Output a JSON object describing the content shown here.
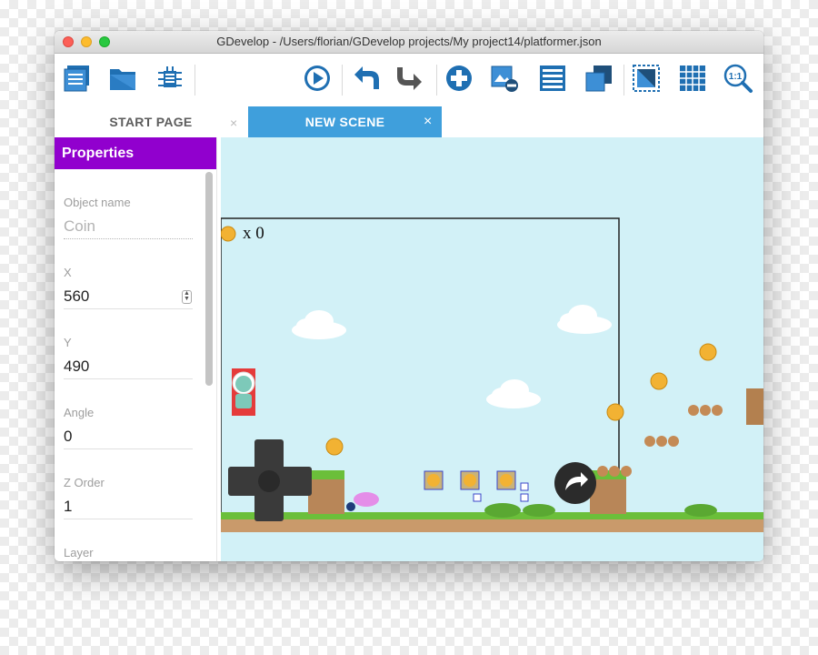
{
  "window": {
    "title": "GDevelop - /Users/florian/GDevelop projects/My project14/platformer.json"
  },
  "toolbar": {
    "left_icons": [
      "project-manager-icon",
      "open-folder-icon",
      "debugger-icon"
    ],
    "right_icons": [
      "preview-play-icon",
      "undo-icon",
      "redo-icon",
      "add-object-icon",
      "layers-remove-icon",
      "object-list-icon",
      "object-groups-icon",
      "window-mask-icon",
      "grid-icon",
      "zoom-reset-icon"
    ],
    "zoom_label": "1:1"
  },
  "tabs": [
    {
      "label": "START PAGE",
      "active": false,
      "close": "×"
    },
    {
      "label": "NEW SCENE",
      "active": true,
      "close": "×"
    }
  ],
  "properties": {
    "header": "Properties",
    "fields": [
      {
        "label": "Object name",
        "value": "Coin"
      },
      {
        "label": "X",
        "value": "560"
      },
      {
        "label": "Y",
        "value": "490"
      },
      {
        "label": "Angle",
        "value": "0"
      },
      {
        "label": "Z Order",
        "value": "1"
      },
      {
        "label": "Layer",
        "value": ""
      }
    ]
  },
  "scene": {
    "hud_text": "x 0",
    "background_color": "#d2f1f7",
    "accent_color": "#3f9fdc",
    "header_color": "#9100ce"
  }
}
